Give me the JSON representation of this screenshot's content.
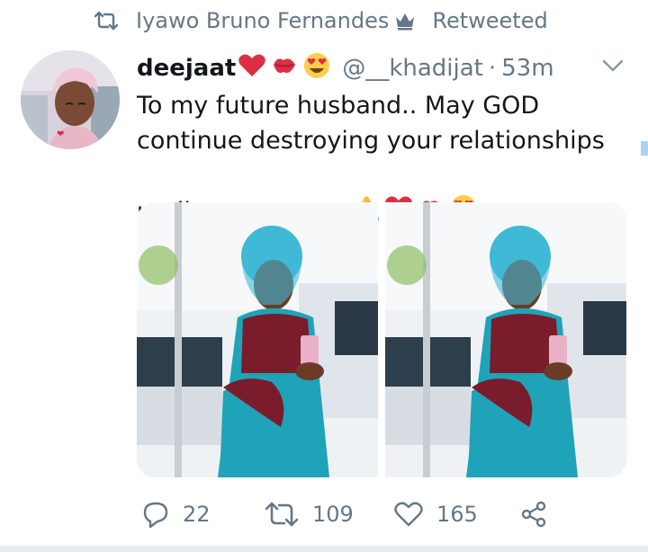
{
  "retweet_banner": {
    "icon": "retweet-icon",
    "name": "Iyawo Bruno Fernandes",
    "name_icon": "crown-icon",
    "suffix": "Retweeted"
  },
  "tweet": {
    "display_name": "deejaat",
    "name_emojis": [
      "red-heart",
      "kiss-mark",
      "heart-eyes-face"
    ],
    "handle": "@__khadijat",
    "separator": "·",
    "time": "53m",
    "text_line1": "To my future husband.. May GOD",
    "text_line2": "continue destroying your relationships",
    "text_line3": "until we meet",
    "text_emojis": [
      "folded-hands",
      "red-heart",
      "kiss-mark",
      "heart-eyes-face"
    ],
    "photos": [
      "woman in turquoise headwrap and patterned dress holding phone",
      "woman in turquoise headwrap and patterned dress holding phone"
    ]
  },
  "actions": {
    "replies": "22",
    "retweets": "109",
    "likes": "165"
  },
  "colors": {
    "muted": "#657786",
    "text": "#14171a",
    "fabric_teal": "#1fa3b8",
    "fabric_maroon": "#7a1c2b",
    "headwrap": "#3fb9d6"
  }
}
